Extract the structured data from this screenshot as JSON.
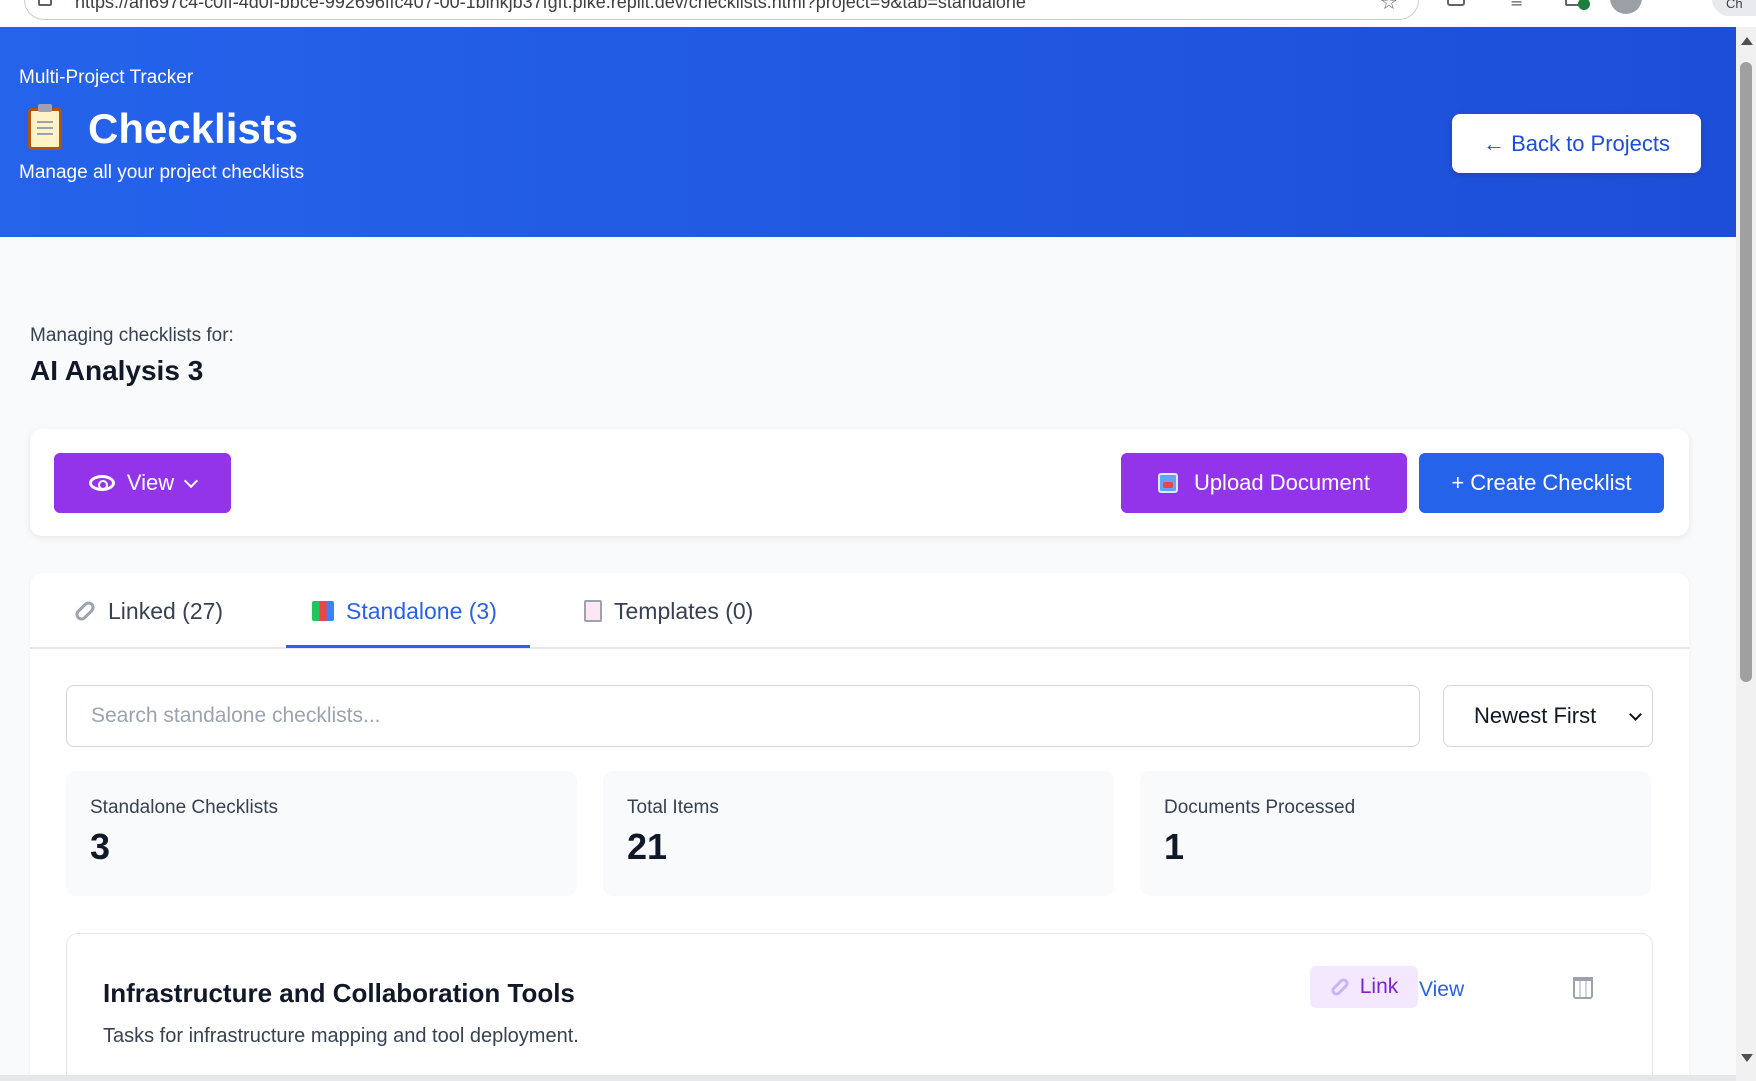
{
  "browser": {
    "url": "https://an697c4-c0ff-4d0f-bbce-992696ffc407-00-1binkjb37fgft.pike.replit.dev/checklists.html?project=9&tab=standalone",
    "chrome_label": "Ch"
  },
  "header": {
    "app_name": "Multi-Project Tracker",
    "title": "Checklists",
    "subtitle": "Manage all your project checklists",
    "back_button": "← Back to Projects"
  },
  "project": {
    "managing_label": "Managing checklists for:",
    "name": "AI Analysis 3"
  },
  "toolbar": {
    "view_label": "View",
    "upload_label": "Upload Document",
    "create_label": "+ Create Checklist"
  },
  "tabs": [
    {
      "label": "Linked (27)",
      "icon": "link-icon",
      "active": false
    },
    {
      "label": "Standalone (3)",
      "icon": "books-icon",
      "active": true
    },
    {
      "label": "Templates (0)",
      "icon": "template-icon",
      "active": false
    }
  ],
  "search": {
    "placeholder": "Search standalone checklists...",
    "value": ""
  },
  "sort": {
    "selected": "Newest First"
  },
  "stats": [
    {
      "label": "Standalone Checklists",
      "value": "3"
    },
    {
      "label": "Total Items",
      "value": "21"
    },
    {
      "label": "Documents Processed",
      "value": "1"
    }
  ],
  "checklists": [
    {
      "title": "Infrastructure and Collaboration Tools",
      "description": "Tasks for infrastructure mapping and tool deployment.",
      "view_label": "View",
      "link_label": "Link"
    }
  ],
  "colors": {
    "header_blue": "#2563eb",
    "purple": "#9333ea",
    "active_tab": "#2563eb"
  }
}
